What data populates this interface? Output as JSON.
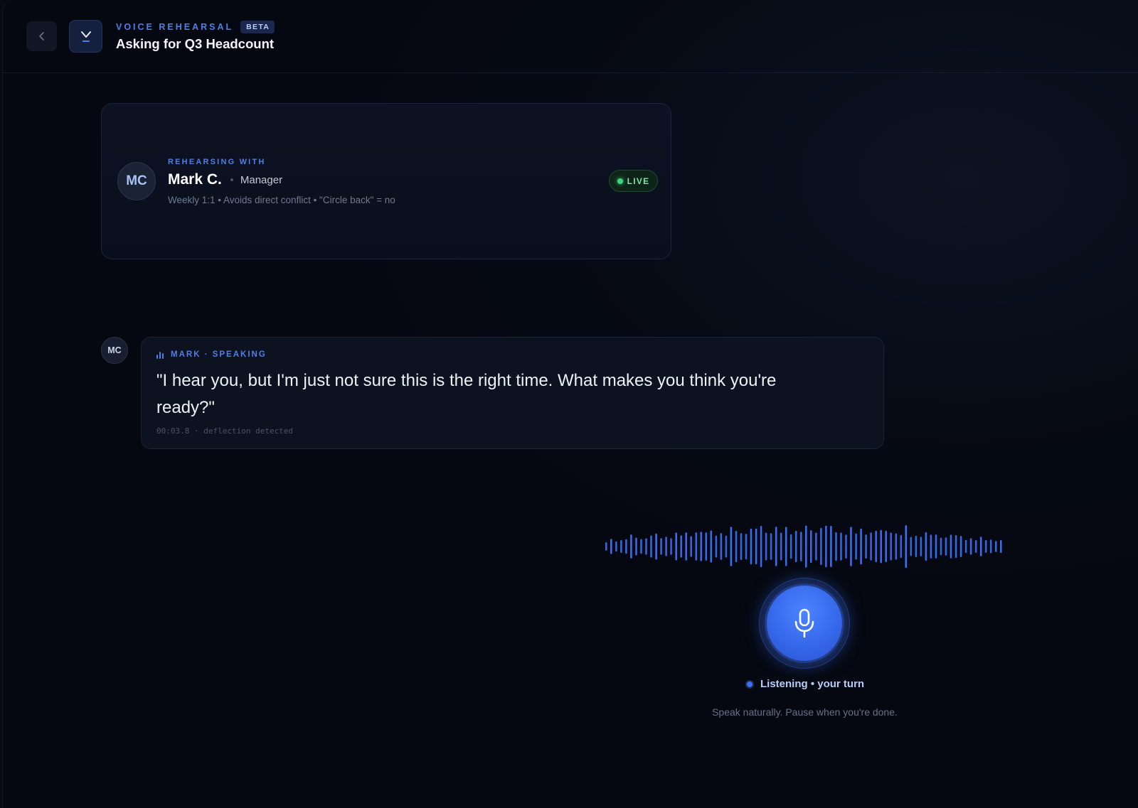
{
  "header": {
    "kicker": "VOICE REHEARSAL",
    "badge": "BETA",
    "title": "Asking for Q3 Headcount",
    "back_icon": "chevron-left-icon",
    "logo_icon": "chevron-down-logo-icon"
  },
  "persona": {
    "label": "REHEARSING WITH",
    "initials": "MC",
    "name": "Mark C.",
    "role": "Manager",
    "notes": "Weekly 1:1 • Avoids direct conflict • \"Circle back\" = no",
    "status": "LIVE",
    "status_color": "#3ed27a"
  },
  "message": {
    "avatar_initials": "MC",
    "speaker": "MARK · SPEAKING",
    "quote": "\"I hear you, but I'm just not sure this is the right time. What makes you think you're ready?\"",
    "meta": "00:03.8 · deflection detected"
  },
  "voice": {
    "status": "Listening • your turn",
    "hint": "Speak naturally. Pause when you're done.",
    "accent_color": "#3b6ef0",
    "mic_icon": "microphone-icon"
  }
}
